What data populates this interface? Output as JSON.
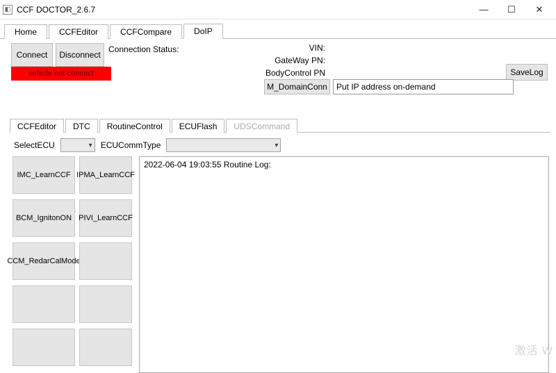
{
  "window": {
    "title": "CCF DOCTOR_2.6.7",
    "icon_glyph": "◧",
    "min_glyph": "—",
    "max_glyph": "☐",
    "close_glyph": "✕"
  },
  "main_tabs": [
    "Home",
    "CCFEditor",
    "CCFCompare",
    "DoIP"
  ],
  "main_tab_active": 3,
  "conn": {
    "connect_label": "Connect",
    "disconnect_label": "Disconnect",
    "status_label": "Connection Status:",
    "status_value": "",
    "red_msg": "vehicle not connect"
  },
  "info": {
    "vin_label": "VIN:",
    "vin_value": "",
    "gateway_label": "GateWay PN:",
    "gateway_value": "",
    "bodycontrol_label": "BodyControl PN",
    "bodycontrol_value": ""
  },
  "savelog_label": "SaveLog",
  "domain": {
    "button_label": "M_DomainConn",
    "ip_placeholder": "",
    "ip_value": "Put IP address on-demand"
  },
  "sub_tabs": [
    "CCFEditor",
    "DTC",
    "RoutineControl",
    "ECUFlash",
    "UDSCommand"
  ],
  "sub_tab_active": 2,
  "sub_tab_disabled": [
    4
  ],
  "select_row": {
    "selectecu_label": "SelectECU",
    "selectecu_value": "",
    "ecucomm_label": "ECUCommType",
    "ecucomm_value": ""
  },
  "routine_buttons": [
    "IMC_LearnCCF",
    "IPMA_LearnCCF",
    "BCM_IgnitonON",
    "PIVI_LearnCCF",
    "CCM_RedarCalMode",
    "",
    "",
    "",
    "",
    ""
  ],
  "log": {
    "text": "2022-06-04 19:03:55  Routine Log:"
  },
  "watermark": "激活 W"
}
